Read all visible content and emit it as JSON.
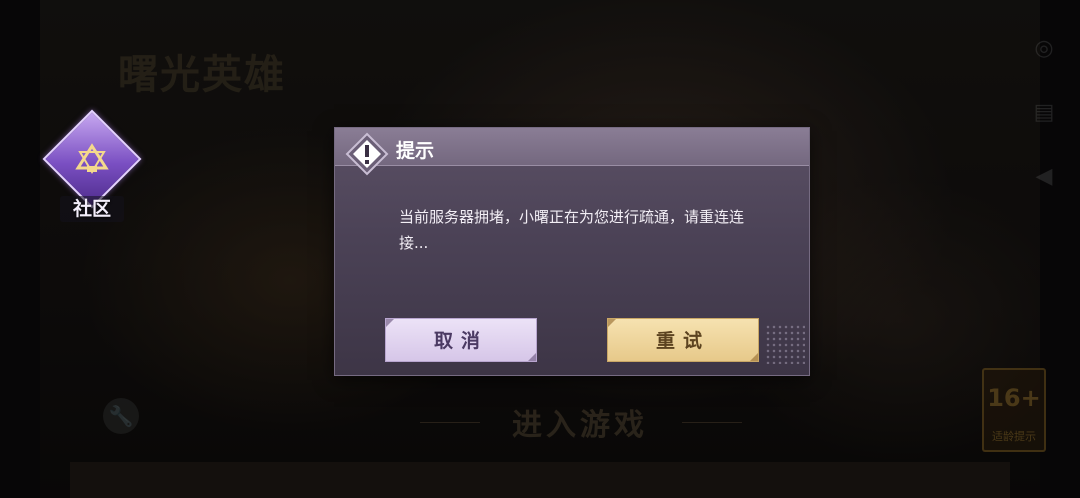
{
  "background": {
    "game_logo": "曙光英雄",
    "enter_game": "进入游戏",
    "side_icons": [
      {
        "name": "wechat-icon",
        "glyph": "◎",
        "label": ""
      },
      {
        "name": "notice-icon",
        "glyph": "▤",
        "label": ""
      },
      {
        "name": "megaphone-icon",
        "glyph": "◀",
        "label": ""
      }
    ],
    "age_badge": {
      "number": "16+",
      "label": "适龄提示"
    },
    "repair_label": ""
  },
  "community": {
    "label": "社区",
    "icon": "community-triangle-icon"
  },
  "dialog": {
    "title": "提示",
    "message": "当前服务器拥堵，小曙正在为您进行疏通，请重连连接...",
    "cancel_label": "取消",
    "retry_label": "重试"
  },
  "colors": {
    "dialog_bg": "#4b4256",
    "dialog_header": "#8a7d95",
    "cancel_bg": "#e4d8f1",
    "retry_bg": "#efd59c"
  }
}
